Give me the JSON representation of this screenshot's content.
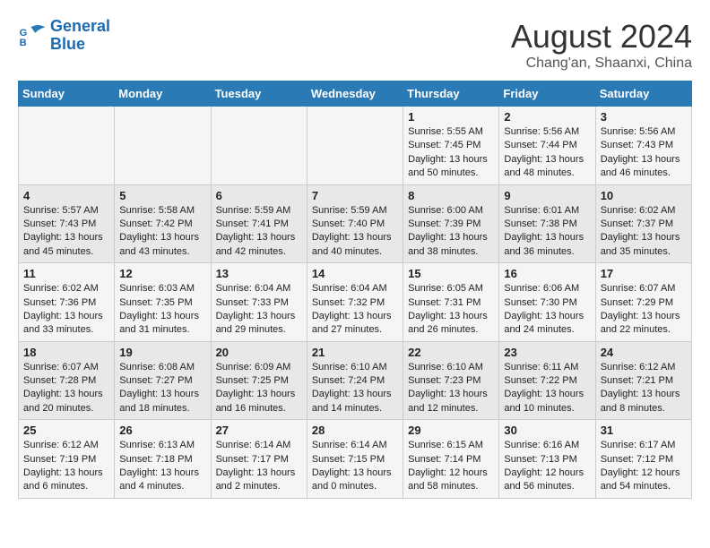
{
  "header": {
    "logo_line1": "General",
    "logo_line2": "Blue",
    "month_year": "August 2024",
    "location": "Chang'an, Shaanxi, China"
  },
  "days_of_week": [
    "Sunday",
    "Monday",
    "Tuesday",
    "Wednesday",
    "Thursday",
    "Friday",
    "Saturday"
  ],
  "weeks": [
    [
      {
        "day": "",
        "info": ""
      },
      {
        "day": "",
        "info": ""
      },
      {
        "day": "",
        "info": ""
      },
      {
        "day": "",
        "info": ""
      },
      {
        "day": "1",
        "info": "Sunrise: 5:55 AM\nSunset: 7:45 PM\nDaylight: 13 hours\nand 50 minutes."
      },
      {
        "day": "2",
        "info": "Sunrise: 5:56 AM\nSunset: 7:44 PM\nDaylight: 13 hours\nand 48 minutes."
      },
      {
        "day": "3",
        "info": "Sunrise: 5:56 AM\nSunset: 7:43 PM\nDaylight: 13 hours\nand 46 minutes."
      }
    ],
    [
      {
        "day": "4",
        "info": "Sunrise: 5:57 AM\nSunset: 7:43 PM\nDaylight: 13 hours\nand 45 minutes."
      },
      {
        "day": "5",
        "info": "Sunrise: 5:58 AM\nSunset: 7:42 PM\nDaylight: 13 hours\nand 43 minutes."
      },
      {
        "day": "6",
        "info": "Sunrise: 5:59 AM\nSunset: 7:41 PM\nDaylight: 13 hours\nand 42 minutes."
      },
      {
        "day": "7",
        "info": "Sunrise: 5:59 AM\nSunset: 7:40 PM\nDaylight: 13 hours\nand 40 minutes."
      },
      {
        "day": "8",
        "info": "Sunrise: 6:00 AM\nSunset: 7:39 PM\nDaylight: 13 hours\nand 38 minutes."
      },
      {
        "day": "9",
        "info": "Sunrise: 6:01 AM\nSunset: 7:38 PM\nDaylight: 13 hours\nand 36 minutes."
      },
      {
        "day": "10",
        "info": "Sunrise: 6:02 AM\nSunset: 7:37 PM\nDaylight: 13 hours\nand 35 minutes."
      }
    ],
    [
      {
        "day": "11",
        "info": "Sunrise: 6:02 AM\nSunset: 7:36 PM\nDaylight: 13 hours\nand 33 minutes."
      },
      {
        "day": "12",
        "info": "Sunrise: 6:03 AM\nSunset: 7:35 PM\nDaylight: 13 hours\nand 31 minutes."
      },
      {
        "day": "13",
        "info": "Sunrise: 6:04 AM\nSunset: 7:33 PM\nDaylight: 13 hours\nand 29 minutes."
      },
      {
        "day": "14",
        "info": "Sunrise: 6:04 AM\nSunset: 7:32 PM\nDaylight: 13 hours\nand 27 minutes."
      },
      {
        "day": "15",
        "info": "Sunrise: 6:05 AM\nSunset: 7:31 PM\nDaylight: 13 hours\nand 26 minutes."
      },
      {
        "day": "16",
        "info": "Sunrise: 6:06 AM\nSunset: 7:30 PM\nDaylight: 13 hours\nand 24 minutes."
      },
      {
        "day": "17",
        "info": "Sunrise: 6:07 AM\nSunset: 7:29 PM\nDaylight: 13 hours\nand 22 minutes."
      }
    ],
    [
      {
        "day": "18",
        "info": "Sunrise: 6:07 AM\nSunset: 7:28 PM\nDaylight: 13 hours\nand 20 minutes."
      },
      {
        "day": "19",
        "info": "Sunrise: 6:08 AM\nSunset: 7:27 PM\nDaylight: 13 hours\nand 18 minutes."
      },
      {
        "day": "20",
        "info": "Sunrise: 6:09 AM\nSunset: 7:25 PM\nDaylight: 13 hours\nand 16 minutes."
      },
      {
        "day": "21",
        "info": "Sunrise: 6:10 AM\nSunset: 7:24 PM\nDaylight: 13 hours\nand 14 minutes."
      },
      {
        "day": "22",
        "info": "Sunrise: 6:10 AM\nSunset: 7:23 PM\nDaylight: 13 hours\nand 12 minutes."
      },
      {
        "day": "23",
        "info": "Sunrise: 6:11 AM\nSunset: 7:22 PM\nDaylight: 13 hours\nand 10 minutes."
      },
      {
        "day": "24",
        "info": "Sunrise: 6:12 AM\nSunset: 7:21 PM\nDaylight: 13 hours\nand 8 minutes."
      }
    ],
    [
      {
        "day": "25",
        "info": "Sunrise: 6:12 AM\nSunset: 7:19 PM\nDaylight: 13 hours\nand 6 minutes."
      },
      {
        "day": "26",
        "info": "Sunrise: 6:13 AM\nSunset: 7:18 PM\nDaylight: 13 hours\nand 4 minutes."
      },
      {
        "day": "27",
        "info": "Sunrise: 6:14 AM\nSunset: 7:17 PM\nDaylight: 13 hours\nand 2 minutes."
      },
      {
        "day": "28",
        "info": "Sunrise: 6:14 AM\nSunset: 7:15 PM\nDaylight: 13 hours\nand 0 minutes."
      },
      {
        "day": "29",
        "info": "Sunrise: 6:15 AM\nSunset: 7:14 PM\nDaylight: 12 hours\nand 58 minutes."
      },
      {
        "day": "30",
        "info": "Sunrise: 6:16 AM\nSunset: 7:13 PM\nDaylight: 12 hours\nand 56 minutes."
      },
      {
        "day": "31",
        "info": "Sunrise: 6:17 AM\nSunset: 7:12 PM\nDaylight: 12 hours\nand 54 minutes."
      }
    ]
  ]
}
